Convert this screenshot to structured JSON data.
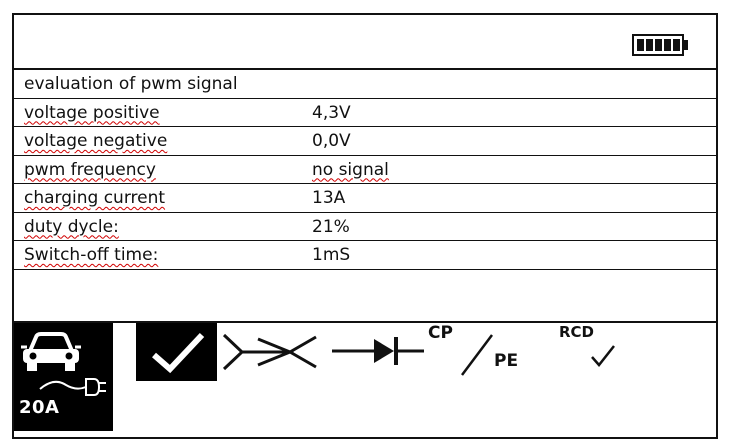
{
  "header": {
    "battery_icon": "battery-full-icon"
  },
  "rows": [
    {
      "label": "evaluation of pwm signal",
      "value": ""
    },
    {
      "label": "voltage positive",
      "value": "4,3V"
    },
    {
      "label": "voltage negative",
      "value": "0,0V"
    },
    {
      "label": "pwm frequency",
      "value": "no signal"
    },
    {
      "label": "charging current",
      "value": "13A"
    },
    {
      "label": "duty dycle:",
      "value": "21%"
    },
    {
      "label": "Switch-off time:",
      "value": "1mS"
    }
  ],
  "status_bar": {
    "ev_current": "20A",
    "cp_label": "CP",
    "pe_label": "PE",
    "rcd_label": "RCD",
    "icons": [
      "car-icon",
      "plug-icon",
      "checkmark-icon",
      "short-circuit-icon",
      "diode-icon",
      "slash-icon",
      "small-check-icon"
    ]
  },
  "colors": {
    "foreground": "#111111",
    "background": "#ffffff",
    "spellcheck": "#d00000"
  }
}
